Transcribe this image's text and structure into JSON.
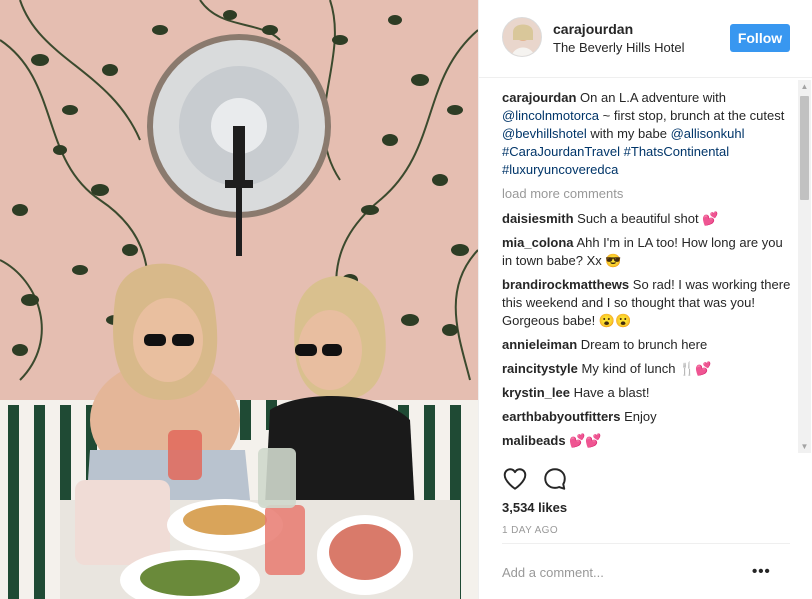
{
  "post": {
    "username": "carajourdan",
    "location": "The Beverly Hills Hotel",
    "follow_label": "Follow"
  },
  "caption": {
    "username": "carajourdan",
    "t1": " On an L.A adventure with ",
    "m1": "@lincolnmotorca",
    "t2": " ~ first stop, brunch at the cutest ",
    "m2": "@bevhillshotel",
    "t3": " with my babe ",
    "m3": "@allisonkuhl",
    "t4": " ",
    "h1": "#CaraJourdanTravel",
    "t5": " ",
    "h2": "#ThatsContinental",
    "t6": " ",
    "h3": "#luxuryuncoveredca"
  },
  "load_more": "load more comments",
  "comments": [
    {
      "user": "daisiesmith",
      "text": "Such a beautiful shot 💕"
    },
    {
      "user": "mia_colona",
      "text": "Ahh I'm in LA too! How long are you in town babe? Xx 😎"
    },
    {
      "user": "brandirockmatthews",
      "text": "So rad! I was working there this weekend and I so thought that was you! Gorgeous babe! 😮😮"
    },
    {
      "user": "annieleiman",
      "text": "Dream to brunch here"
    },
    {
      "user": "raincitystyle",
      "text": "My kind of lunch 🍴💕"
    },
    {
      "user": "krystin_lee",
      "text": "Have a blast!"
    },
    {
      "user": "earthbabyoutfitters",
      "text": "Enjoy"
    },
    {
      "user": "malibeads",
      "text": "💕💕"
    }
  ],
  "stats": {
    "likes": "3,534 likes",
    "time": "1 DAY AGO"
  },
  "add_comment_placeholder": "Add a comment...",
  "more_label": "•••",
  "icons": {
    "like": "heart-icon",
    "comment": "comment-bubble-icon",
    "more": "more-options-icon"
  },
  "colors": {
    "follow_button": "#3897f0",
    "link": "#003569",
    "muted": "#999999"
  }
}
